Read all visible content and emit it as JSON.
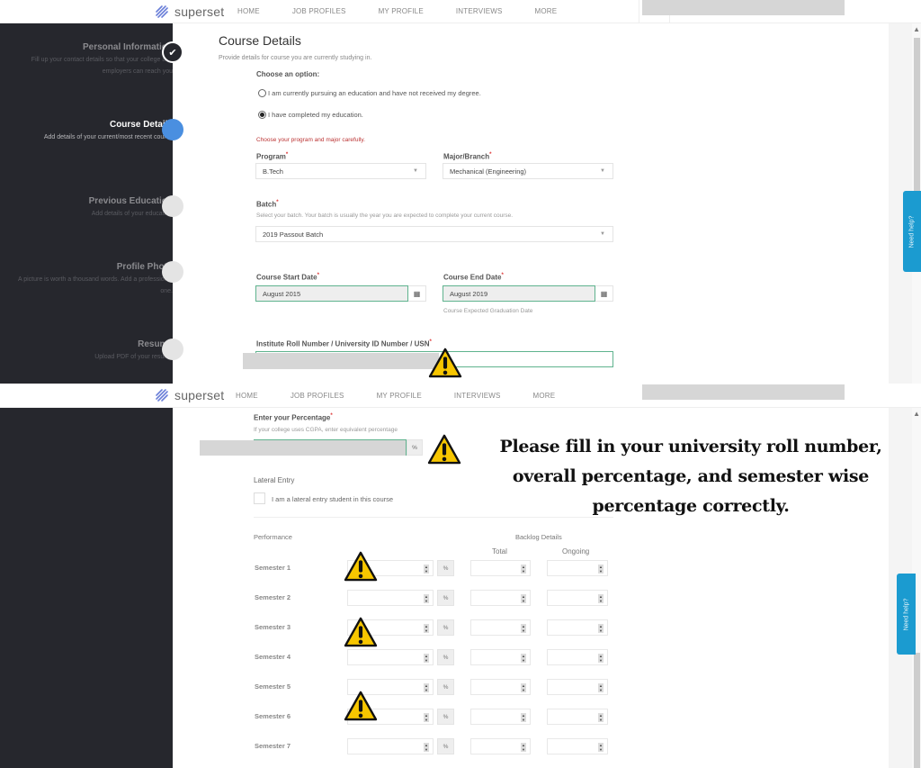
{
  "navbar": {
    "brand": "superset",
    "links": [
      "HOME",
      "JOB PROFILES",
      "MY PROFILE",
      "INTERVIEWS",
      "MORE"
    ]
  },
  "sidebar": {
    "steps": [
      {
        "title": "Personal Information",
        "desc": "Fill up your contact details so that your college and employers can reach you",
        "state": "done"
      },
      {
        "title": "Course Details",
        "desc": "Add details of your current/most recent course",
        "state": "active"
      },
      {
        "title": "Previous Education",
        "desc": "Add details of your education",
        "state": "pending"
      },
      {
        "title": "Profile Photo",
        "desc": "A picture is worth a thousand words. Add a professional one.",
        "state": "pending"
      },
      {
        "title": "Resume",
        "desc": "Upload PDF of your resume",
        "state": "pending"
      }
    ]
  },
  "form": {
    "title": "Course Details",
    "subtitle": "Provide details for course you are currently studying in.",
    "choose_label": "Choose an option:",
    "options": [
      {
        "label": "I am currently pursuing an education and have not received my degree.",
        "checked": false
      },
      {
        "label": "I have completed my education.",
        "checked": true
      }
    ],
    "program_warning": "Choose your program and major carefully.",
    "program": {
      "label": "Program",
      "value": "B.Tech"
    },
    "major": {
      "label": "Major/Branch",
      "value": "Mechanical (Engineering)"
    },
    "batch": {
      "label": "Batch",
      "hint": "Select your batch. Your batch is usually the year you are expected to complete your current course.",
      "value": "2019 Passout Batch"
    },
    "start_date": {
      "label": "Course Start Date",
      "value": "August 2015"
    },
    "end_date": {
      "label": "Course End Date",
      "value": "August 2019",
      "hint": "Course Expected Graduation Date"
    },
    "roll_number": {
      "label": "Institute Roll Number / University ID Number / USN",
      "value": ""
    },
    "percentage": {
      "label": "Enter your Percentage",
      "hint": "If your college uses CGPA, enter equivalent percentage",
      "suffix": "%",
      "value": ""
    },
    "lateral": {
      "label": "Lateral Entry",
      "checkbox_label": "I am a lateral entry student in this course",
      "checked": false
    },
    "performance": {
      "label": "Performance",
      "backlog_label": "Backlog Details",
      "total_label": "Total",
      "ongoing_label": "Ongoing",
      "pct_suffix": "%",
      "semesters": [
        "Semester 1",
        "Semester 2",
        "Semester 3",
        "Semester 4",
        "Semester 5",
        "Semester 6",
        "Semester 7"
      ]
    }
  },
  "help_tab": "Need help?",
  "required_mark": "*",
  "calendar_glyph": "▦",
  "caret_glyph": "▼",
  "check_glyph": "✔",
  "callout": "Please fill in your university roll number, overall percentage, and semester wise percentage correctly.",
  "colors": {
    "accent": "#4a8fe0",
    "sidebar_bg": "#26272d",
    "help": "#1b9bd0",
    "focus_border": "#5fb38e",
    "warning_icon": "#f7c600"
  }
}
